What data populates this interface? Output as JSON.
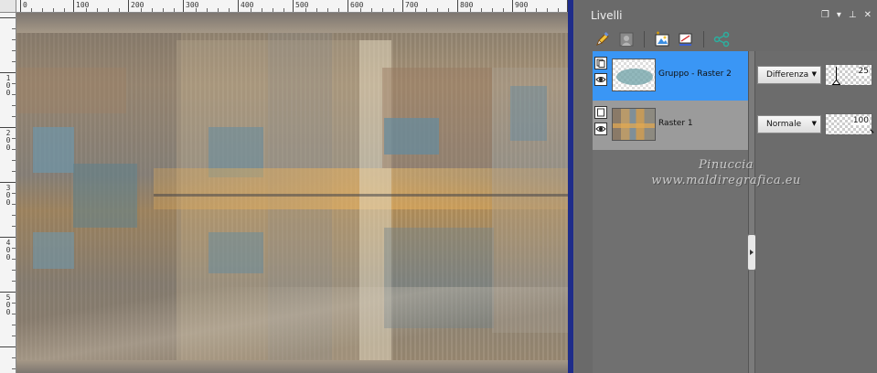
{
  "canvas": {
    "ruler_top_labels": [
      "0",
      "100",
      "200",
      "300",
      "400",
      "500",
      "600",
      "700",
      "800",
      "900"
    ],
    "ruler_left_labels": [
      "1\n0\n0",
      "2\n0\n0",
      "3\n0\n0",
      "4\n0\n0",
      "5\n0\n0"
    ]
  },
  "layers_panel": {
    "title": "Livelli",
    "controls": {
      "restore": "❐",
      "menu": "▾",
      "pin": "⊥",
      "close": "✕"
    },
    "layers": [
      {
        "name": "Gruppo - Raster 2",
        "blend_mode": "Differenza",
        "opacity": "25",
        "selected": true
      },
      {
        "name": "Raster 1",
        "blend_mode": "Normale",
        "opacity": "100",
        "selected": false
      }
    ],
    "watermark_line1": "Pinuccia",
    "watermark_line2": "www.maldiregrafica.eu"
  },
  "colors": {
    "selected_layer": "#3a96f5",
    "panel_bg": "#6a6a6a"
  }
}
